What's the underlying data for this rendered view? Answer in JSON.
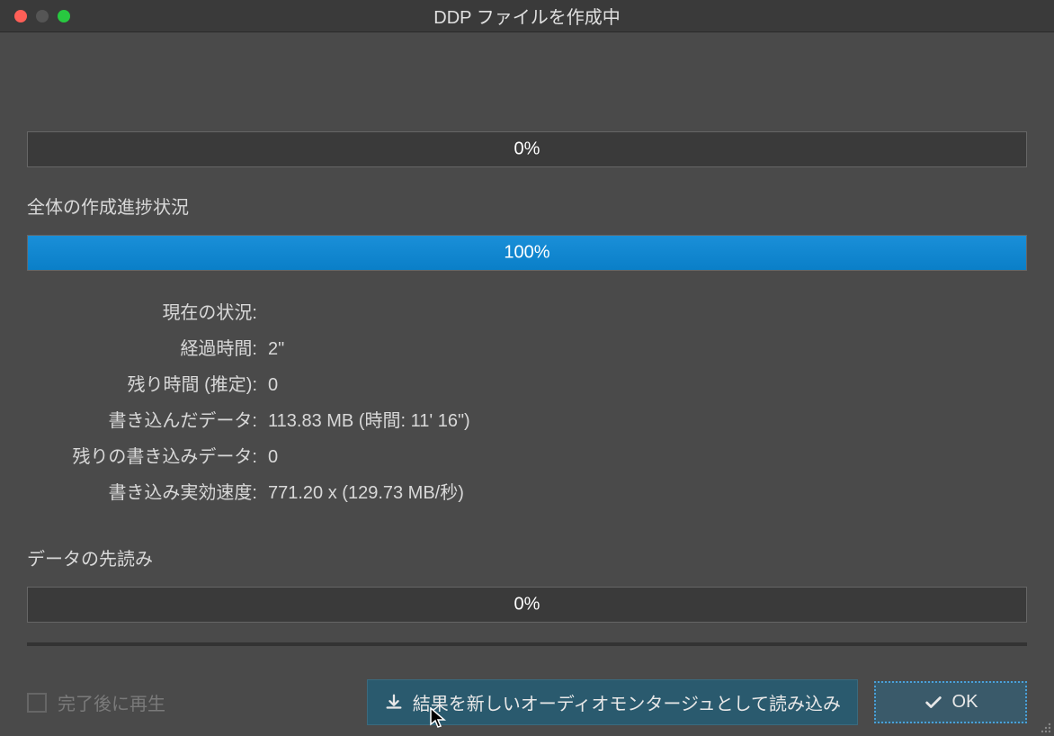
{
  "window": {
    "title": "DDP ファイルを作成中"
  },
  "progress1": {
    "percent": 0,
    "text": "0%"
  },
  "section1_label": "全体の作成進捗状況",
  "progress2": {
    "percent": 100,
    "text": "100%"
  },
  "stats": {
    "current_status": {
      "label": "現在の状況:",
      "value": ""
    },
    "elapsed": {
      "label": "経過時間:",
      "value": "2\""
    },
    "remaining": {
      "label": "残り時間 (推定):",
      "value": "0"
    },
    "written": {
      "label": "書き込んだデータ:",
      "value": "113.83 MB (時間: 11' 16\")"
    },
    "remaining_data": {
      "label": "残りの書き込みデータ:",
      "value": "0"
    },
    "speed": {
      "label": "書き込み実効速度:",
      "value": "771.20 x (129.73 MB/秒)"
    }
  },
  "section2_label": "データの先読み",
  "progress3": {
    "percent": 0,
    "text": "0%"
  },
  "footer": {
    "checkbox_label": "完了後に再生",
    "load_button": "結果を新しいオーディオモンタージュとして読み込み",
    "ok_button": "OK"
  }
}
